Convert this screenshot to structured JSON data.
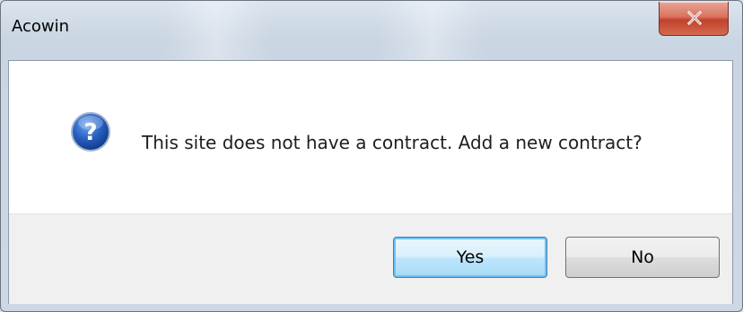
{
  "window": {
    "title": "Acowin",
    "close_icon": "close-icon"
  },
  "dialog": {
    "icon": "question-icon",
    "message": "This site does not have a contract.  Add a new contract?"
  },
  "buttons": {
    "yes_label": "Yes",
    "no_label": "No",
    "default": "yes"
  },
  "colors": {
    "close_button": "#c1422b",
    "default_button_border": "#3c7fb1",
    "icon_blue": "#1f5bb5"
  }
}
